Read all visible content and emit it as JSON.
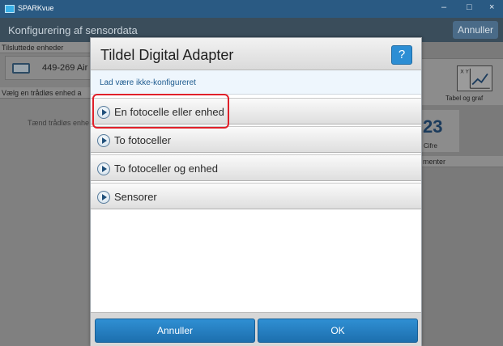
{
  "window": {
    "app_title": "SPARKvue",
    "controls": {
      "minimize": "–",
      "maximize": "□",
      "close": "×"
    }
  },
  "app_header": {
    "title": "Konfigurering af sensordata",
    "cancel_label": "Annuller"
  },
  "background": {
    "connected_devices_label": "Tilsluttede enheder",
    "device_name": "449-269 Air",
    "wireless_select_label": "Vælg en trådløs enhed a",
    "wireless_hint": "Tænd trådløs enhe",
    "tile_graph_label": "Tabel og graf",
    "tile_digits_value": "23",
    "tile_digits_label": "Cifre",
    "experiments_label": "menter"
  },
  "dialog": {
    "title": "Tildel Digital Adapter",
    "help_label": "?",
    "skip_label": "Lad være ikke-konfigureret",
    "options": [
      {
        "label": "En fotocelle eller enhed",
        "highlighted": true
      },
      {
        "label": "To fotoceller"
      },
      {
        "label": "To fotoceller og enhed"
      },
      {
        "label": "Sensorer"
      }
    ],
    "cancel_label": "Annuller",
    "ok_label": "OK"
  },
  "colors": {
    "title_bar": "#2a5a83",
    "accent_button": "#2d8ed4",
    "highlight": "#e0202a"
  }
}
